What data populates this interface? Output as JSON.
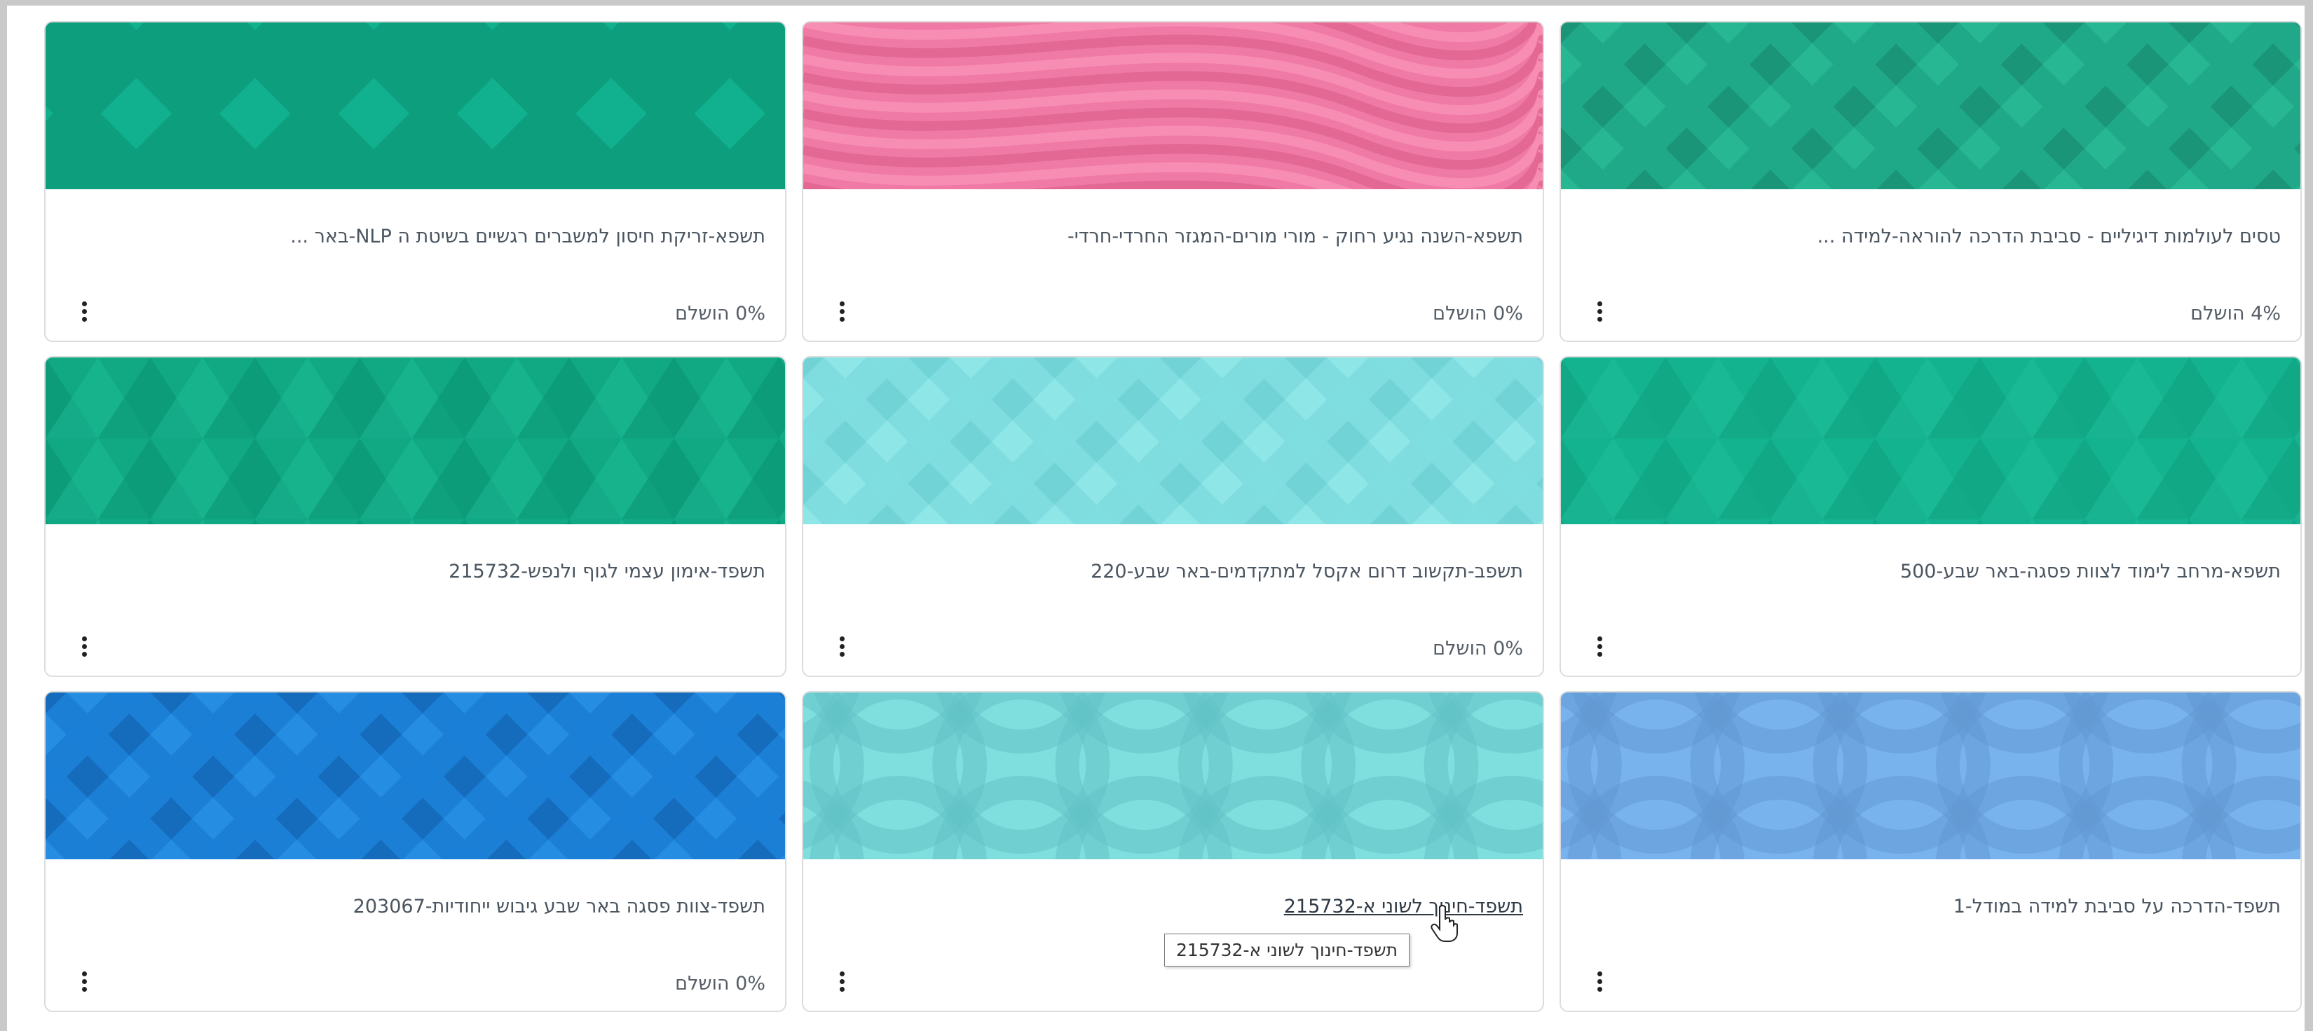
{
  "courses": [
    {
      "title": "טסים לעולמות דיגיליים - סביבת הדרכה להוראה-למידה ...",
      "progress": "4% הושלם",
      "progress_value": 4,
      "image_pattern": "diamonds",
      "colors": [
        "#20a989",
        "#1a8f73",
        "#2bbc97"
      ]
    },
    {
      "title": "תשפא-השנה נגיע רחוק - מורי מורים-המגזר החרדי-חרדי-",
      "progress": "0% הושלם",
      "progress_value": 0,
      "image_pattern": "waves",
      "colors": [
        "#f07aa6",
        "#e0648f",
        "#fa92b8"
      ]
    },
    {
      "title": "תשפא-זריקת חיסון למשברים רגשיים בשיטת ה NLP-באר ...",
      "progress": "0% הושלם",
      "progress_value": 0,
      "image_pattern": "octagons",
      "colors": [
        "#11b08e",
        "#0c9a7b",
        "#23c19d"
      ]
    },
    {
      "title": "תשפא-מרחב לימוד לצוות פסגה-באר שבע-500",
      "progress": "",
      "image_pattern": "triangles",
      "colors": [
        "#14b38f",
        "#0fa080",
        "#22c29e"
      ]
    },
    {
      "title": "תשפב-תקשוב דרום אקסל למתקדמים-באר שבע-220",
      "progress": "0% הושלם",
      "progress_value": 0,
      "image_pattern": "diamonds",
      "colors": [
        "#7fdde0",
        "#6ccfd3",
        "#93e8ea"
      ]
    },
    {
      "title": "תשפד-אימון עצמי לגוף ולנפש-215732",
      "progress": "",
      "image_pattern": "triangles",
      "colors": [
        "#10a984",
        "#0c9473",
        "#1fbe98"
      ]
    },
    {
      "title": "תשפד-הדרכה על סביבת למידה במודל-1",
      "progress": "",
      "image_pattern": "circles",
      "colors": [
        "#79b3ee",
        "#6399d4",
        "#8ec3f5"
      ]
    },
    {
      "title": "תשפד-חינוך לשוני א-215732",
      "progress": "",
      "hovered": true,
      "image_pattern": "circles",
      "colors": [
        "#7fdede",
        "#62c3c6",
        "#95eaea"
      ]
    },
    {
      "title": "תשפד-צוות פסגה באר שבע גיבוש ייחודיות-203067",
      "progress": "0% הושלם",
      "progress_value": 0,
      "image_pattern": "diamonds",
      "colors": [
        "#1b7fd6",
        "#1666b3",
        "#2a92e6"
      ]
    }
  ],
  "tooltip": {
    "text": "תשפד-חינוך לשוני א-215732"
  },
  "icons": {
    "menu": "vertical-dots-icon",
    "cursor": "hand-pointer-icon"
  }
}
